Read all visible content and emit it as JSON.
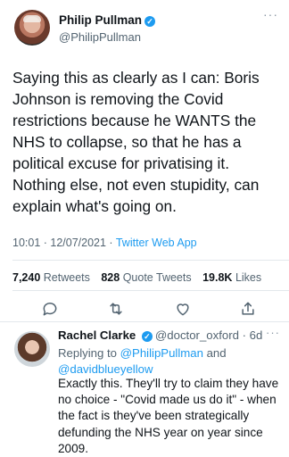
{
  "main_tweet": {
    "author_name": "Philip Pullman",
    "author_handle": "@PhilipPullman",
    "verified_glyph": "✓",
    "more_glyph": "···",
    "text": "Saying this as clearly as I can: Boris Johnson is removing the Covid restrictions because he WANTS the NHS to collapse, so that he has a political excuse for privatising it. Nothing else, not even stupidity, can explain what's going on.",
    "time": "10:01",
    "dot": " · ",
    "date": "12/07/2021",
    "app": "Twitter Web App",
    "stats": {
      "retweets_count": "7,240",
      "retweets_label": "Retweets",
      "quotes_count": "828",
      "quotes_label": "Quote Tweets",
      "likes_count": "19.8K",
      "likes_label": "Likes"
    },
    "actions": [
      "reply-icon",
      "retweet-icon",
      "like-icon",
      "share-icon"
    ]
  },
  "reply_tweet": {
    "author_name": "Rachel Clarke",
    "author_handle": "@doctor_oxford",
    "age_separator": " · ",
    "age": "6d",
    "more_glyph": "···",
    "replying_prefix": "Replying to ",
    "replying_mention_1": "@PhilipPullman",
    "replying_and": " and",
    "replying_mention_2": "@davidblueyellow",
    "text": "Exactly this. They'll try to claim they have no choice - \"Covid made us do it\" - when the fact is they've been strategically defunding the NHS year on year since 2009."
  },
  "colors": {
    "text_primary": "#0f1419",
    "text_secondary": "#536471",
    "accent": "#1d9bf0",
    "divider": "#e3e8ec"
  }
}
